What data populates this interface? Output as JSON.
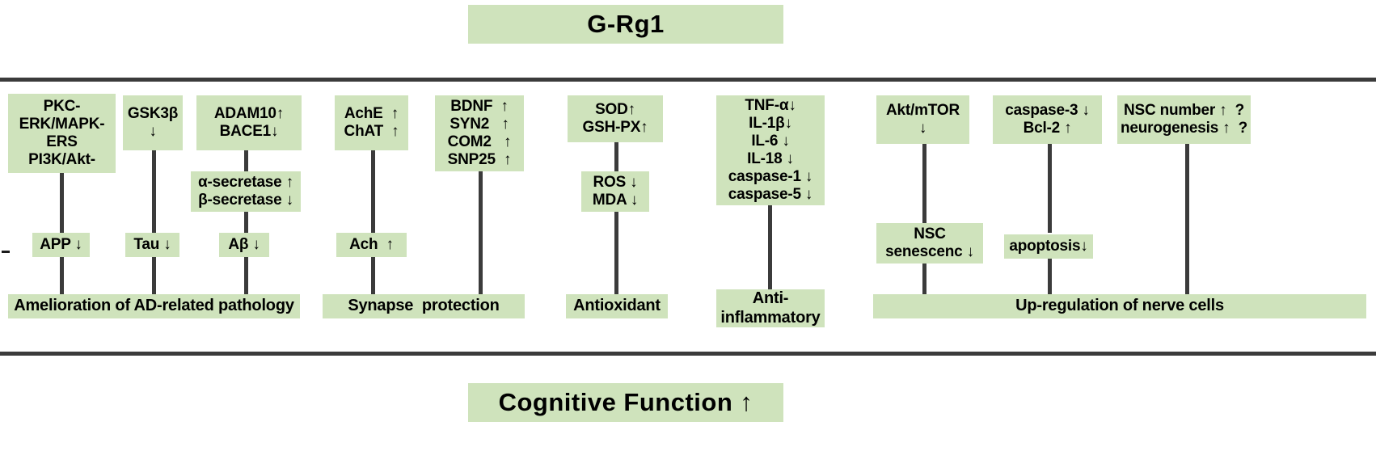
{
  "figure": {
    "title": "G-Rg1",
    "footer": "Cognitive Function ↑"
  },
  "nodes": {
    "pkc": [
      "PKC-",
      "ERK/MAPK-",
      "ERS",
      "PI3K/Akt-"
    ],
    "gsk3b": [
      "GSK3β",
      "↓"
    ],
    "adam10": [
      "ADAM10↑",
      "BACE1↓"
    ],
    "secretase": [
      "α-secretase ↑",
      "β-secretase ↓"
    ],
    "app": [
      "APP ↓"
    ],
    "tau": [
      "Tau ↓"
    ],
    "abeta": [
      "Aβ ↓"
    ],
    "ache": [
      "AchE  ↑",
      "ChAT  ↑"
    ],
    "bdnf": [
      "BDNF  ↑",
      "SYN2   ↑",
      "COM2   ↑",
      "SNP25  ↑"
    ],
    "ach": [
      "Ach  ↑"
    ],
    "sod": [
      "SOD↑",
      "GSH-PX↑"
    ],
    "ros": [
      "ROS ↓",
      "MDA ↓"
    ],
    "cytokines": [
      "TNF-α↓",
      "IL-1β↓",
      "IL-6 ↓",
      "IL-18 ↓",
      "caspase-1 ↓",
      "caspase-5 ↓"
    ],
    "akt_mtor": [
      "Akt/mTOR",
      "↓"
    ],
    "nsc_senescence": [
      "NSC",
      "senescenc ↓"
    ],
    "caspase3": [
      "caspase-3 ↓",
      "Bcl-2 ↑"
    ],
    "apoptosis": [
      "apoptosis↓"
    ],
    "nsc_number": [
      "NSC number ↑  ?",
      "neurogenesis ↑  ?"
    ]
  },
  "outcomes": {
    "ad_pathology": [
      "Amelioration of AD-related pathology"
    ],
    "synapse": [
      "Synapse  protection"
    ],
    "antioxidant": [
      "Antioxidant"
    ],
    "anti_inflammatory": [
      "Anti-",
      "inflammatory"
    ],
    "nerve_cells": [
      "Up-regulation of nerve cells"
    ]
  },
  "colors": {
    "box_fill": "#cfe3bc",
    "line": "#3b3b3b",
    "text": "#000000",
    "background": "#ffffff"
  }
}
